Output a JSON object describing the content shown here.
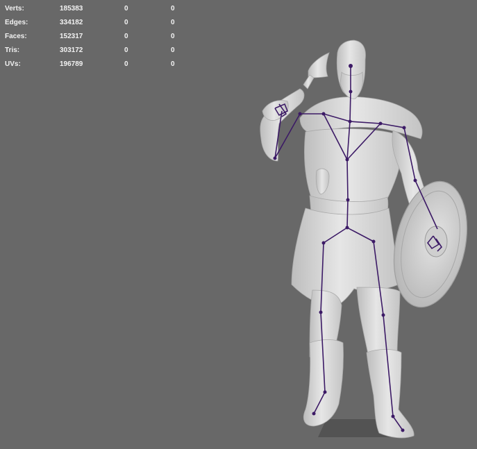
{
  "hud": {
    "rows": [
      {
        "label": "Verts:",
        "total": "185383",
        "selected": "0",
        "component": "0"
      },
      {
        "label": "Edges:",
        "total": "334182",
        "selected": "0",
        "component": "0"
      },
      {
        "label": "Faces:",
        "total": "152317",
        "selected": "0",
        "component": "0"
      },
      {
        "label": "Tris:",
        "total": "303172",
        "selected": "0",
        "component": "0"
      },
      {
        "label": "UVs:",
        "total": "196789",
        "selected": "0",
        "component": "0"
      }
    ]
  },
  "colors": {
    "viewport_bg": "#686868",
    "mesh": "#d9d9d9",
    "skeleton": "#3c1a66"
  },
  "icons": {
    "model": "viking-warrior-mesh",
    "rig": "skeleton-joint-rig"
  }
}
